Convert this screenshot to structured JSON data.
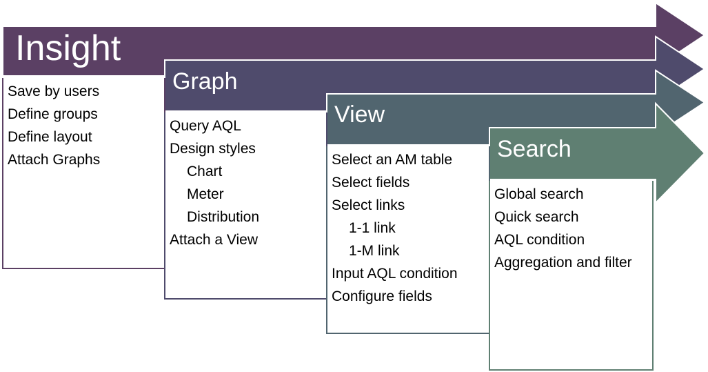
{
  "stages": [
    {
      "id": "insight",
      "title": "Insight",
      "color": "#5b4064",
      "items": [
        {
          "text": "Save by users",
          "level": 0
        },
        {
          "text": "Define groups",
          "level": 0
        },
        {
          "text": "Define layout",
          "level": 0
        },
        {
          "text": "Attach Graphs",
          "level": 0
        }
      ]
    },
    {
      "id": "graph",
      "title": "Graph",
      "color": "#4f4b6c",
      "items": [
        {
          "text": "Query AQL",
          "level": 0
        },
        {
          "text": "Design styles",
          "level": 0
        },
        {
          "text": "Chart",
          "level": 1
        },
        {
          "text": "Meter",
          "level": 1
        },
        {
          "text": "Distribution",
          "level": 1
        },
        {
          "text": "Attach a View",
          "level": 0
        }
      ]
    },
    {
      "id": "view",
      "title": "View",
      "color": "#51656f",
      "items": [
        {
          "text": "Select an AM table",
          "level": 0
        },
        {
          "text": "Select fields",
          "level": 0
        },
        {
          "text": "Select links",
          "level": 0
        },
        {
          "text": "1-1 link",
          "level": 1
        },
        {
          "text": "1-M link",
          "level": 1
        },
        {
          "text": "Input AQL condition",
          "level": 0
        },
        {
          "text": "Configure fields",
          "level": 0
        }
      ]
    },
    {
      "id": "search",
      "title": "Search",
      "color": "#5f7f72",
      "items": [
        {
          "text": "Global search",
          "level": 0
        },
        {
          "text": "Quick search",
          "level": 0
        },
        {
          "text": "AQL condition",
          "level": 0
        },
        {
          "text": "Aggregation and filter",
          "level": 0
        }
      ]
    }
  ]
}
